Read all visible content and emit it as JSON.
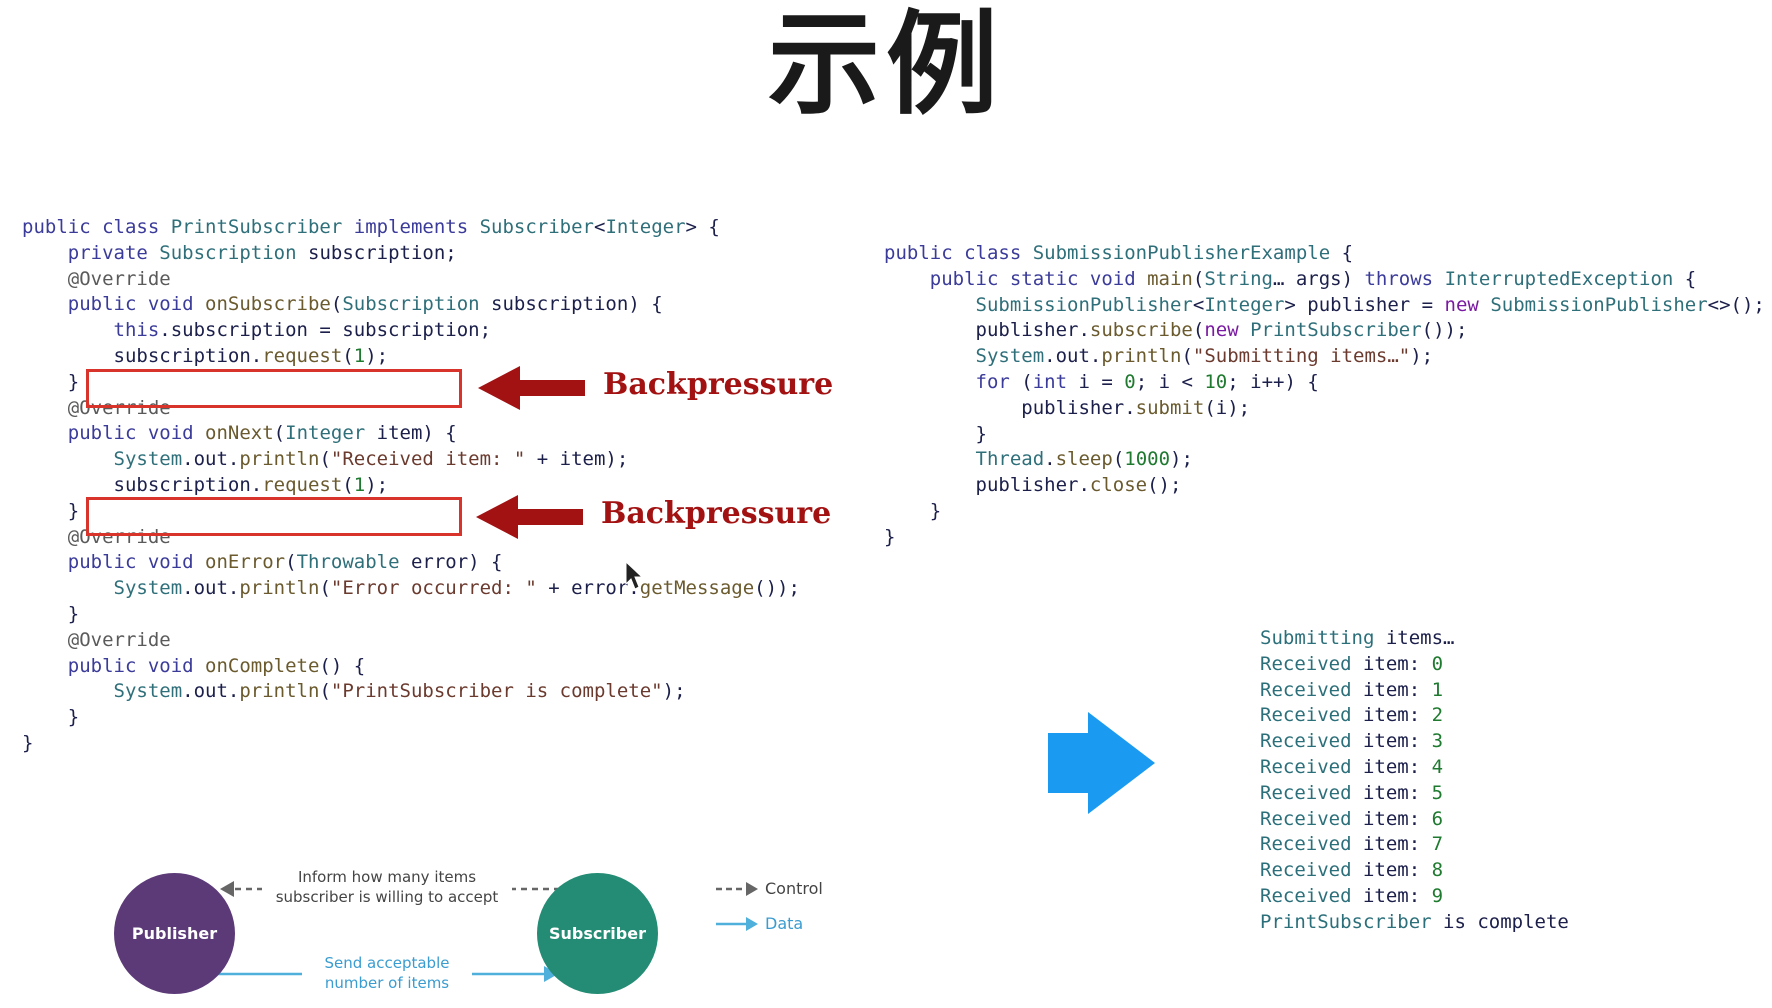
{
  "title": "示例",
  "subscriber_code": {
    "l1": {
      "a": "public class ",
      "b": "PrintSubscriber ",
      "c": "implements ",
      "d": "Subscriber",
      "e": "<",
      "f": "Integer",
      "g": "> {"
    },
    "l2": {
      "a": "    private ",
      "b": "Subscription ",
      "c": "subscription;"
    },
    "l3": {
      "a": "    @Override"
    },
    "l4": {
      "a": "    public void ",
      "b": "onSubscribe",
      "c": "(",
      "d": "Subscription ",
      "e": "subscription) {"
    },
    "l5": {
      "a": "        this",
      "b": ".subscription = subscription;"
    },
    "l6": {
      "a": "        subscription.",
      "b": "request",
      "c": "(",
      "d": "1",
      "e": ");"
    },
    "l7": {
      "a": "    }"
    },
    "l8": {
      "a": "    @Override"
    },
    "l9": {
      "a": "    public void ",
      "b": "onNext",
      "c": "(",
      "d": "Integer ",
      "e": "item) {"
    },
    "l10": {
      "a": "        System",
      "b": ".out.",
      "c": "println",
      "d": "(",
      "e": "\"Received item: \"",
      "f": " + item);"
    },
    "l11": {
      "a": "        subscription.",
      "b": "request",
      "c": "(",
      "d": "1",
      "e": ");"
    },
    "l12": {
      "a": "    }"
    },
    "l13": {
      "a": "    @Override"
    },
    "l14": {
      "a": "    public void ",
      "b": "onError",
      "c": "(",
      "d": "Throwable ",
      "e": "error) {"
    },
    "l15": {
      "a": "        System",
      "b": ".out.",
      "c": "println",
      "d": "(",
      "e": "\"Error occurred: \"",
      "f": " + error.",
      "g": "getMessage",
      "h": "());"
    },
    "l16": {
      "a": "    }"
    },
    "l17": {
      "a": "    @Override"
    },
    "l18": {
      "a": "    public void ",
      "b": "onComplete",
      "c": "() {"
    },
    "l19": {
      "a": "        System",
      "b": ".out.",
      "c": "println",
      "d": "(",
      "e": "\"PrintSubscriber is complete\"",
      "f": ");"
    },
    "l20": {
      "a": "    }"
    },
    "l21": {
      "a": "}"
    }
  },
  "publisher_code": {
    "l1": {
      "a": "public class ",
      "b": "SubmissionPublisherExample ",
      "c": "{"
    },
    "l2": {
      "a": "    public static void ",
      "b": "main",
      "c": "(",
      "d": "String",
      "e": "… args) ",
      "f": "throws ",
      "g": "InterruptedException ",
      "h": "{"
    },
    "l3": {
      "a": "        SubmissionPublisher",
      "b": "<",
      "c": "Integer",
      "d": "> publisher = ",
      "e": "new ",
      "f": "SubmissionPublisher",
      "g": "<>();"
    },
    "l4": {
      "a": "        publisher.",
      "b": "subscribe",
      "c": "(",
      "d": "new ",
      "e": "PrintSubscriber",
      "f": "());"
    },
    "l5": {
      "a": "        System",
      "b": ".out.",
      "c": "println",
      "d": "(",
      "e": "\"Submitting items…\"",
      "f": ");"
    },
    "l6": {
      "a": "        for ",
      "b": "(",
      "c": "int ",
      "d": "i = ",
      "e": "0",
      "f": "; i < ",
      "g": "10",
      "h": "; i++) {"
    },
    "l7": {
      "a": "            publisher.",
      "b": "submit",
      "c": "(i);"
    },
    "l8": {
      "a": "        }"
    },
    "l9": {
      "a": "        Thread",
      "b": ".",
      "c": "sleep",
      "d": "(",
      "e": "1000",
      "f": ");"
    },
    "l10": {
      "a": "        publisher.",
      "b": "close",
      "c": "();"
    },
    "l11": {
      "a": "    }"
    },
    "l12": {
      "a": "}"
    }
  },
  "backpressure_label": "Backpressure",
  "output_lines": {
    "first_a": "Submitting ",
    "first_b": "items…",
    "prefix_a": "Received ",
    "prefix_b": "item: ",
    "items": [
      "0",
      "1",
      "2",
      "3",
      "4",
      "5",
      "6",
      "7",
      "8",
      "9"
    ],
    "last_a": "PrintSubscriber ",
    "last_b": "is complete"
  },
  "diagram": {
    "publisher": "Publisher",
    "subscriber": "Subscriber",
    "control_text_1": "Inform how many items",
    "control_text_2": "subscriber is willing to accept",
    "data_text_1": "Send acceptable",
    "data_text_2": "number of items",
    "legend_control": "Control",
    "legend_data": "Data"
  },
  "colors": {
    "publisher": "#5c3a78",
    "subscriber": "#248c74",
    "result_arrow": "#1a9af0",
    "backpressure": "#a31212",
    "highlight_box": "#d9342b",
    "data_line": "#4fb0dc"
  },
  "icons": [
    "red-arrow-icon",
    "blue-arrow-icon",
    "control-arrow-icon",
    "data-arrow-icon",
    "mouse-cursor-icon"
  ]
}
